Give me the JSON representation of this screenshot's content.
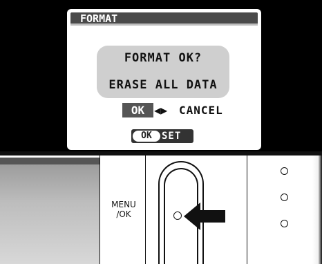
{
  "dialog": {
    "title": "FORMAT",
    "message_line1": "FORMAT OK?",
    "message_line2": "ERASE ALL DATA",
    "ok_option": "OK",
    "arrows": "◀▶",
    "cancel_option": "CANCEL",
    "set_ok": "OK",
    "set_label": "SET"
  },
  "camera": {
    "menu_label_line1": "MENU",
    "menu_label_line2": "/OK"
  }
}
